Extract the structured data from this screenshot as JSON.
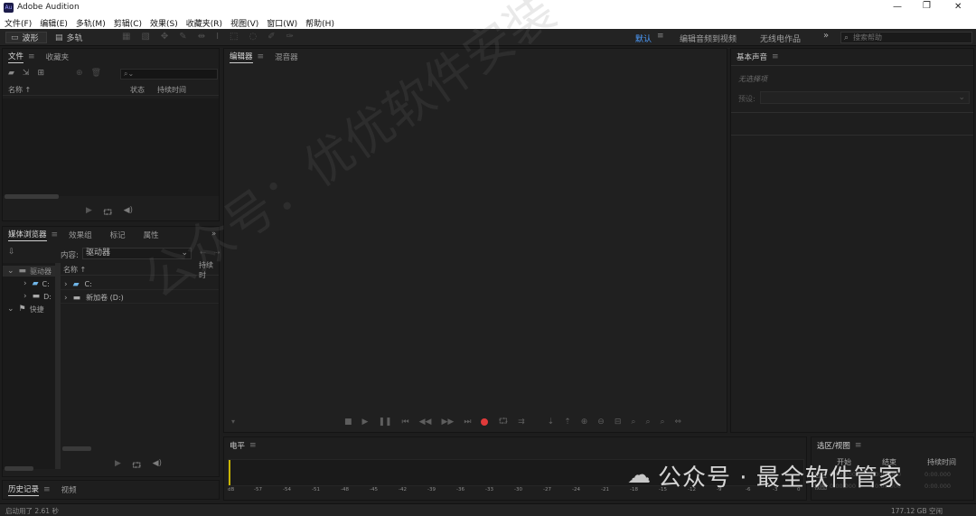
{
  "app": {
    "title": "Adobe Audition",
    "logo": "Au"
  },
  "window_controls": {
    "minimize": "—",
    "maximize": "❐",
    "close": "✕"
  },
  "menu": [
    "文件(F)",
    "编辑(E)",
    "多轨(M)",
    "剪辑(C)",
    "效果(S)",
    "收藏夹(R)",
    "视图(V)",
    "窗口(W)",
    "帮助(H)"
  ],
  "toolbar": {
    "waveform_label": "波形",
    "multitrack_label": "多轨",
    "workspaces": [
      "默认",
      "编辑音频到视频",
      "无线电作品"
    ],
    "more": "»",
    "search_placeholder": "搜索帮助"
  },
  "files_panel": {
    "tabs": [
      "文件",
      "收藏夹"
    ],
    "columns": {
      "name": "名称 ↑",
      "status": "状态",
      "duration": "持续时间"
    }
  },
  "media_browser": {
    "tabs": [
      "媒体浏览器",
      "效果组",
      "标记",
      "属性"
    ],
    "content_label": "内容:",
    "content_value": "驱动器",
    "tree": [
      {
        "label": "驱动器"
      },
      {
        "label": "C:"
      },
      {
        "label": "D:"
      },
      {
        "label": "快捷"
      }
    ],
    "columns": {
      "name": "名称 ↑",
      "duration": "持续时"
    },
    "items": [
      {
        "name": "C:"
      },
      {
        "name": "新加卷 (D:)"
      }
    ]
  },
  "history_panel": {
    "tabs": [
      "历史记录",
      "视频"
    ]
  },
  "editor_panel": {
    "tabs": [
      "编辑器",
      "混音器"
    ]
  },
  "essential_sound": {
    "tab": "基本声音",
    "no_selection": "无选择项",
    "preset_label": "预设:"
  },
  "levels_panel": {
    "tab": "电平",
    "scale": [
      "dB",
      "-57",
      "-54",
      "-51",
      "-48",
      "-45",
      "-42",
      "-39",
      "-36",
      "-33",
      "-30",
      "-27",
      "-24",
      "-21",
      "-18",
      "-15",
      "-12",
      "-9",
      "-6",
      "-3",
      "0"
    ]
  },
  "selection_panel": {
    "tab": "选区/视图",
    "columns": [
      "开始",
      "结束",
      "持续时间"
    ],
    "rows": [
      {
        "label": "选区",
        "values": [
          "0:00.000",
          "0:00.000",
          "0:00.000"
        ]
      },
      {
        "label": "视图",
        "values": [
          "0:00.000",
          "0:00.000",
          "0:00.000"
        ]
      }
    ]
  },
  "status_bar": {
    "left": "启动用了 2.61 秒",
    "right": "177.12 GB 空闲"
  },
  "watermark": {
    "diagonal": "公众号：优优软件安装",
    "bottom": "公众号 · 最全软件管家"
  },
  "colors": {
    "record": "#e03a3a",
    "accent": "#2f8cff"
  }
}
